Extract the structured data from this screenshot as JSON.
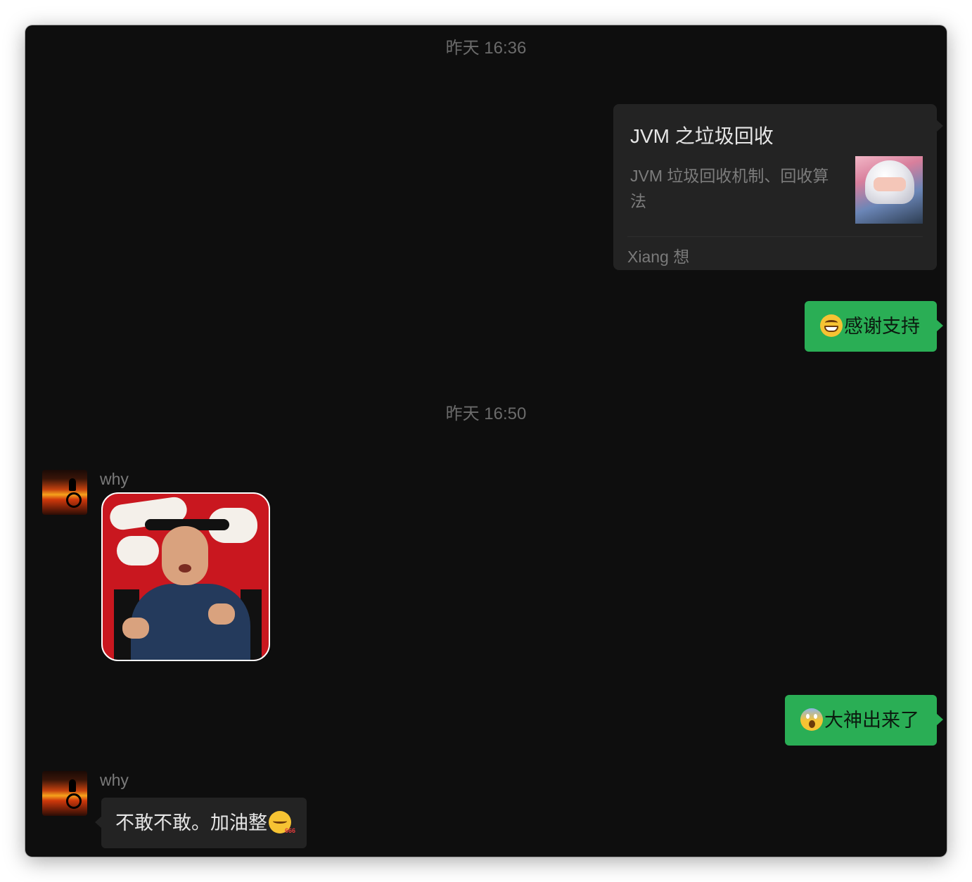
{
  "timestamps": [
    "昨天 16:36",
    "昨天 16:50"
  ],
  "link_card": {
    "title": "JVM 之垃圾回收",
    "description": "JVM 垃圾回收机制、回收算法",
    "source": "Xiang 想"
  },
  "messages": [
    {
      "sender": "",
      "direction": "outgoing",
      "emoji": "grinning-face",
      "text": "感谢支持"
    },
    {
      "sender": "why",
      "direction": "incoming",
      "type": "sticker"
    },
    {
      "sender": "",
      "direction": "outgoing",
      "emoji": "screaming-face",
      "text": "大神出来了"
    },
    {
      "sender": "why",
      "direction": "incoming",
      "emoji": "thinking-666-face",
      "text": "不敢不敢。加油整"
    }
  ],
  "colors": {
    "background": "#0e0e0e",
    "outgoing_bubble": "#2aae55",
    "incoming_bubble": "#232323",
    "timestamp_text": "#6b6b6b"
  }
}
